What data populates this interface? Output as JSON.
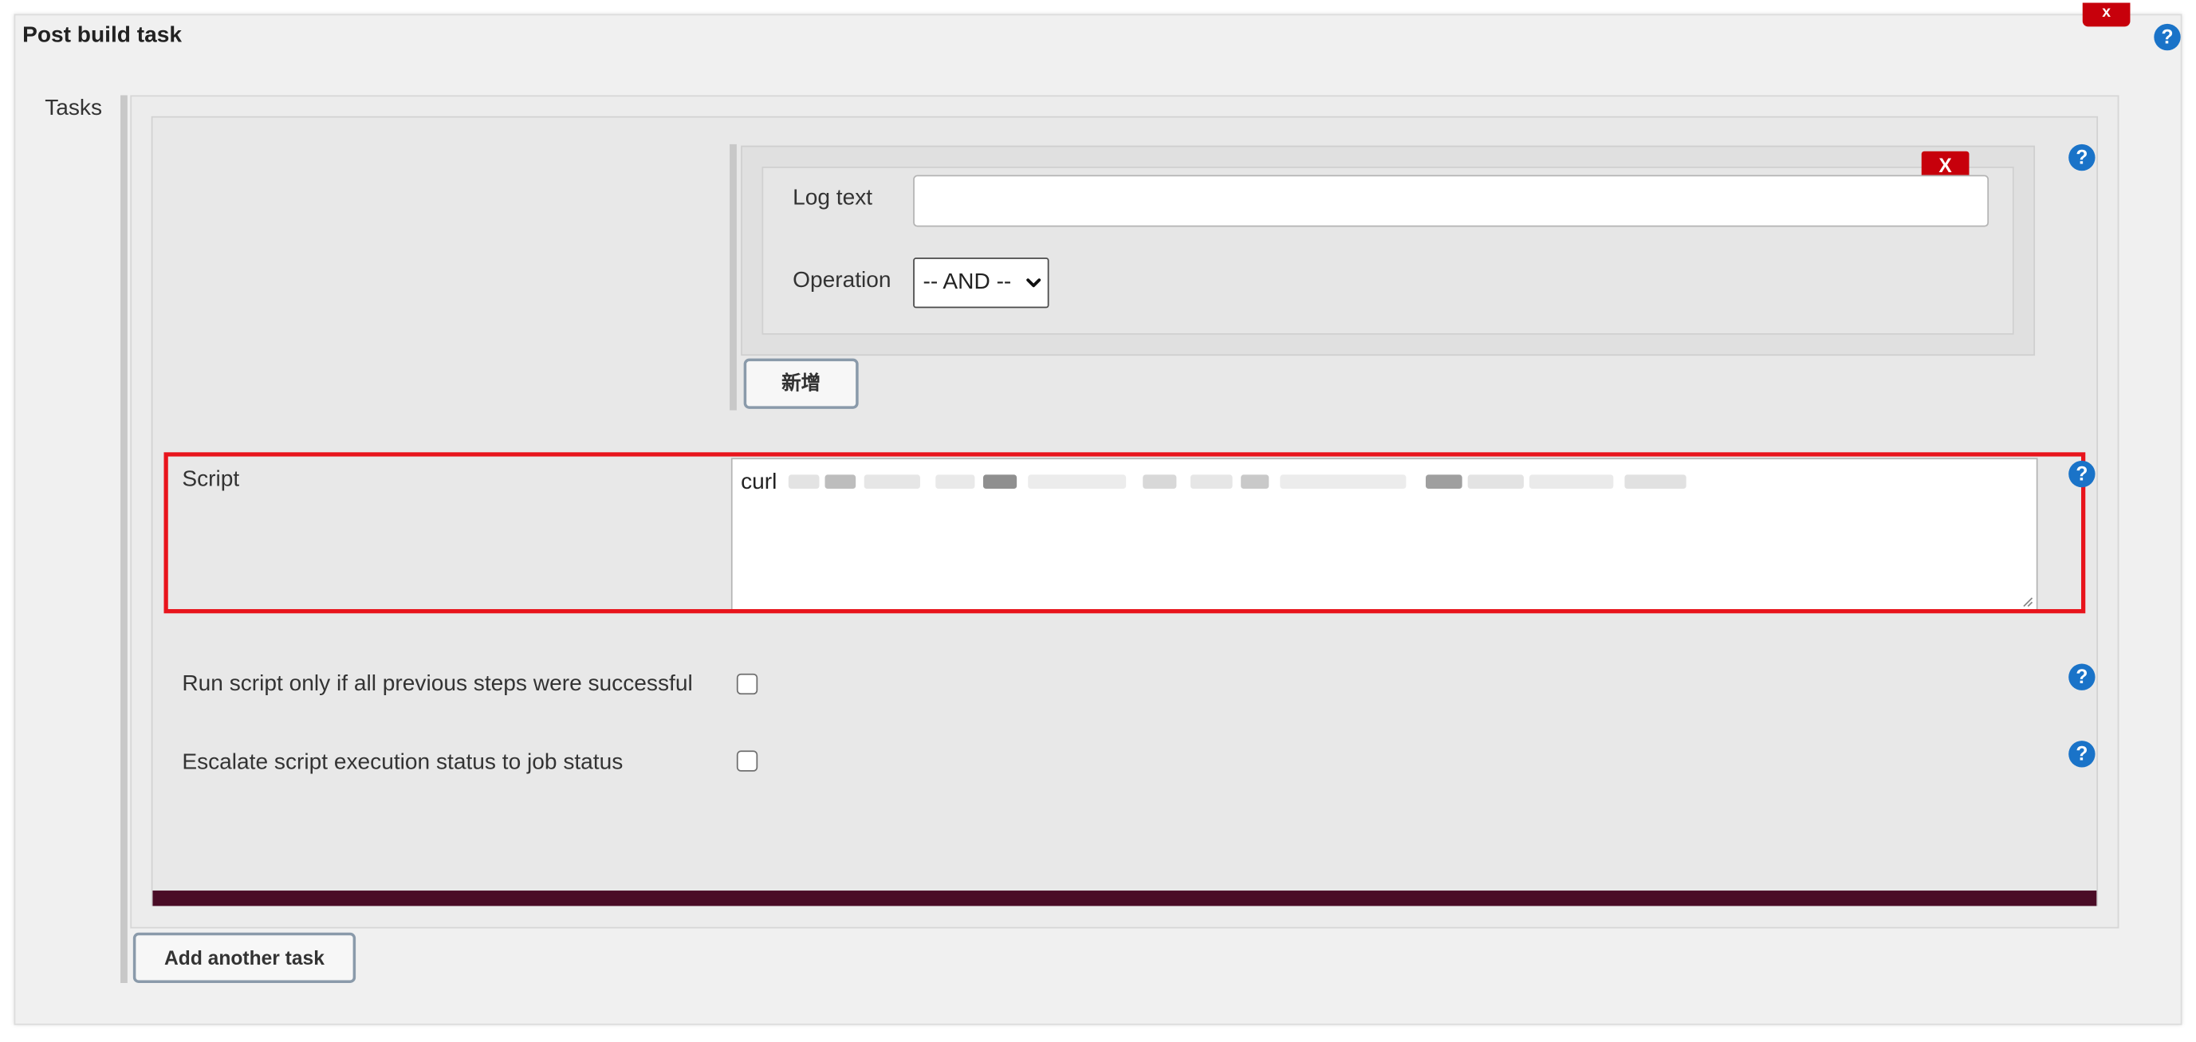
{
  "section": {
    "title": "Post build task",
    "close_label": "x",
    "help_label": "?"
  },
  "tasks": {
    "label": "Tasks",
    "help_label": "?"
  },
  "log_text": {
    "label": "Log text",
    "value": "",
    "remove_label": "X"
  },
  "operation": {
    "label": "Operation",
    "selected": "-- AND --"
  },
  "add_log_button": "新增",
  "script": {
    "label": "Script",
    "value_prefix": "curl",
    "help_label": "?"
  },
  "options": {
    "run_if_success_label": "Run script only if all previous steps were successful",
    "run_if_success_checked": false,
    "escalate_label": "Escalate script execution status to job status",
    "escalate_checked": false,
    "help_label": "?"
  },
  "add_task_button": "Add another task",
  "colors": {
    "remove_red": "#c7000b",
    "help_blue": "#1a73c8",
    "highlight_red": "#e8141c",
    "task_footer": "#4a0c26"
  },
  "icons": {
    "help": "question-circle-icon",
    "remove": "close-icon",
    "dropdown": "chevron-down-icon"
  }
}
